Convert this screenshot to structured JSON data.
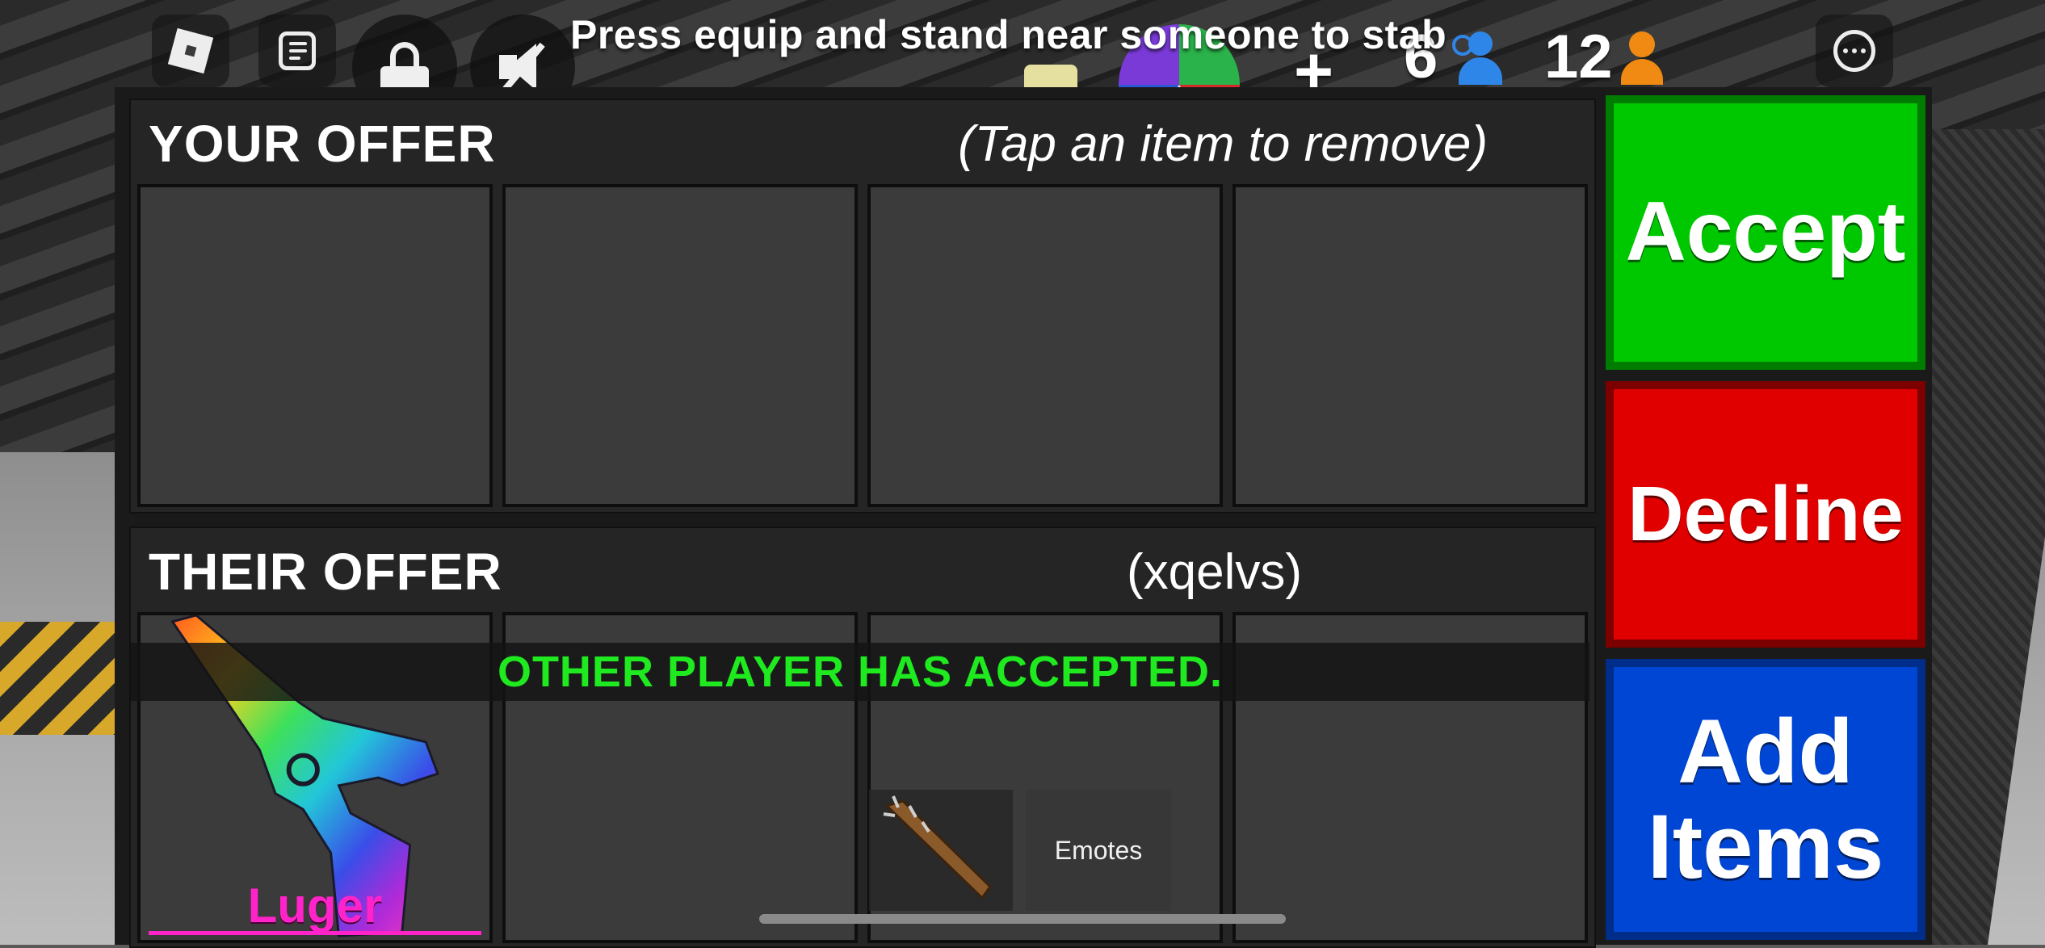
{
  "topbar": {
    "hint": "Press equip and stand near someone to stab",
    "plus_label": "+",
    "friends_count": "6",
    "players_count": "12"
  },
  "trade": {
    "your_offer": {
      "title": "YOUR OFFER",
      "note": "(Tap an item to remove)",
      "slots": [
        "",
        "",
        "",
        ""
      ]
    },
    "their_offer": {
      "title": "THEIR OFFER",
      "username": "(xqelvs)",
      "slots": [
        {
          "item": "Luger",
          "icon": "rainbow-luger-gun-icon"
        },
        {
          "item": ""
        },
        {
          "item": ""
        },
        {
          "item": ""
        }
      ]
    },
    "status": "OTHER PLAYER HAS ACCEPTED.",
    "buttons": {
      "accept": "Accept",
      "decline": "Decline",
      "add_items_line1": "Add",
      "add_items_line2": "Items"
    },
    "colors": {
      "accept": "#00c800",
      "decline": "#e00000",
      "add_items": "#0046d4",
      "status_text": "#1fe91f",
      "item_name": "#ff23c9"
    }
  },
  "hotbar": {
    "weapon_icon": "spiked-bat-icon",
    "emotes_label": "Emotes"
  }
}
